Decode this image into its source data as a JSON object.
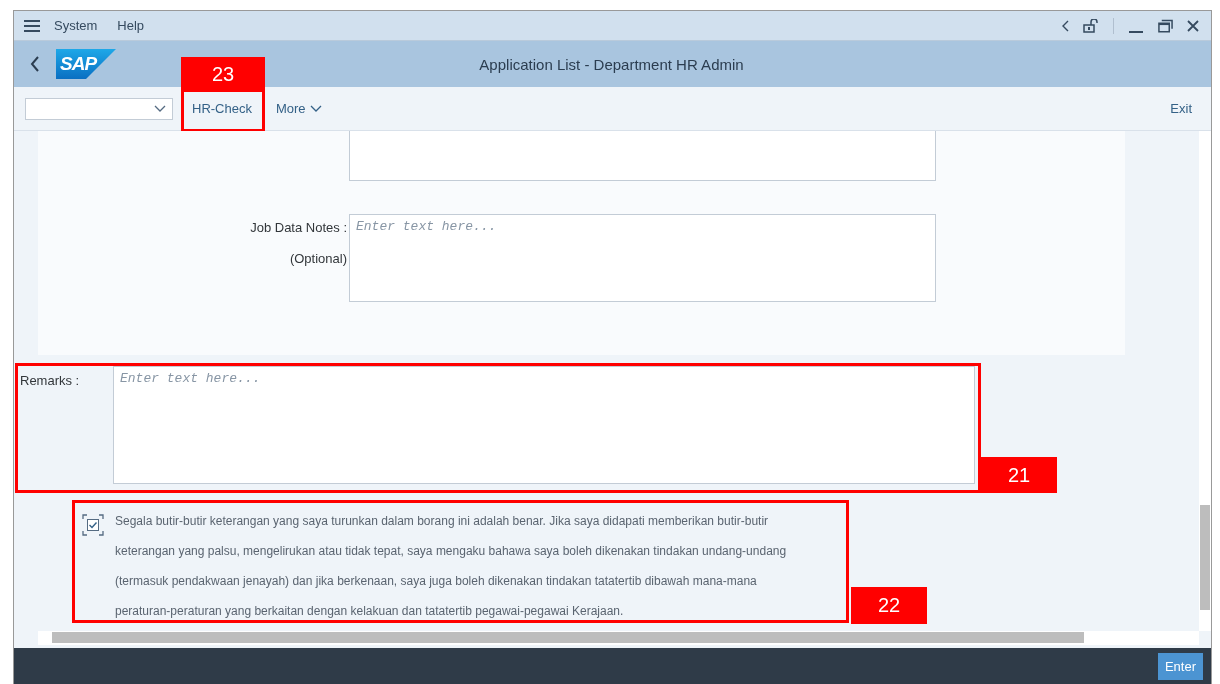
{
  "menu": [
    {
      "label": "System"
    },
    {
      "label": "Help"
    }
  ],
  "logo": "SAP",
  "title": "Application List - Department HR Admin",
  "toolbar": {
    "buttons": [
      {
        "label": "HR-Check",
        "kind": "plain",
        "callout": "23"
      },
      {
        "label": "More",
        "kind": "menu"
      }
    ],
    "exit": "Exit"
  },
  "fields": [
    {
      "label": "Job Data Notes :",
      "sublabel": "(Optional)",
      "placeholder": "Enter text here..."
    }
  ],
  "remarks": {
    "label": "Remarks :",
    "placeholder": "Enter text here...",
    "callout": "21"
  },
  "declaration": {
    "checked": true,
    "callout": "22",
    "text": "Segala butir-butir keterangan yang saya turunkan dalam borang ini adalah benar. Jika saya didapati memberikan butir-butir keterangan yang palsu, mengelirukan atau tidak tepat, saya mengaku bahawa saya boleh dikenakan tindakan undang-undang (termasuk pendakwaan jenayah) dan jika berkenaan, saya juga boleh dikenakan tindakan tatatertib dibawah mana-mana peraturan-peraturan yang berkaitan dengan kelakuan dan tatatertib pegawai-pegawai Kerajaan."
  },
  "footer": {
    "button": "Enter"
  }
}
